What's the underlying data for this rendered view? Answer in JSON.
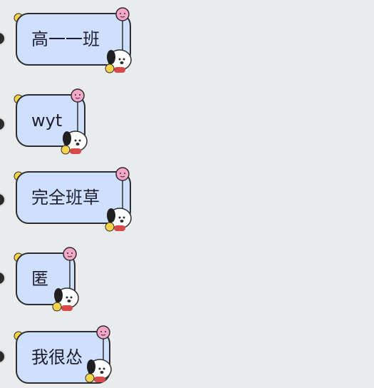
{
  "messages": [
    {
      "text": "高一一班"
    },
    {
      "text": "wyt"
    },
    {
      "text": "完全班草"
    },
    {
      "text": "匿"
    },
    {
      "text": "我很怂"
    }
  ],
  "colors": {
    "background": "#eaebed",
    "bubble_fill": "#cfe0ff",
    "bubble_border": "#2d2d2d",
    "text": "#1e1e2e",
    "balloon": "#f3a6c8"
  },
  "icons": {
    "top_left": "bird-sticker-icon",
    "top_right": "pink-balloon-icon",
    "bottom_right": "pochacco-dog-icon"
  }
}
